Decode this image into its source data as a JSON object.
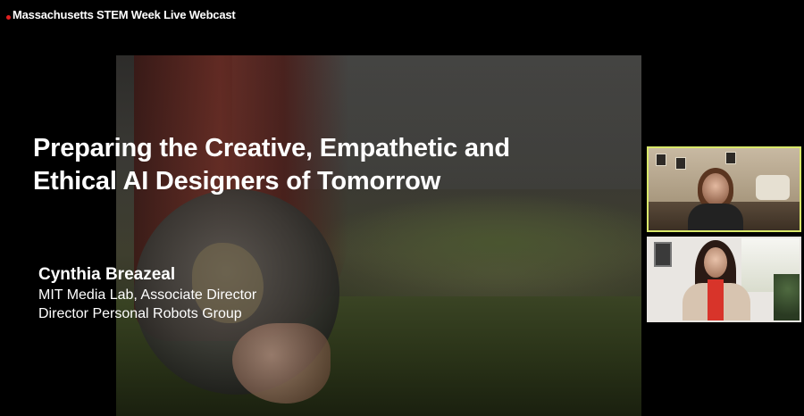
{
  "window": {
    "title": "Massachusetts STEM Week Live Webcast",
    "recording_color": "#e02020"
  },
  "slide": {
    "title_line1": "Preparing the Creative, Empathetic and",
    "title_line2": "Ethical AI Designers of Tomorrow",
    "presenter_name": "Cynthia Breazeal",
    "presenter_role1": "MIT Media Lab, Associate Director",
    "presenter_role2": "Director Personal Robots Group"
  },
  "video_tiles": {
    "active_speaker_border_color": "#d9e86a"
  }
}
